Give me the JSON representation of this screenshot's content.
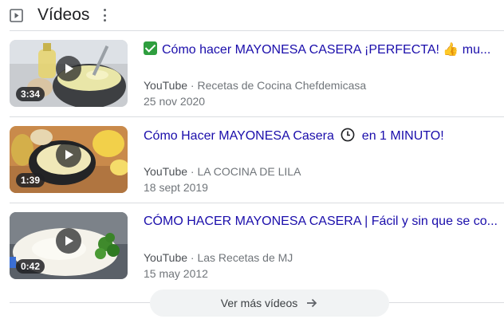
{
  "header": {
    "title": "Vídeos",
    "icon": "play-box-icon",
    "menu_icon": "more-vert-icon"
  },
  "videos": [
    {
      "title_prefix_icon": "check-mark-icon",
      "title": "Cómo hacer MAYONESA CASERA ¡PERFECTA! 👍 mu...",
      "source": "YouTube",
      "channel": "Recetas de Cocina Chefdemicasa",
      "date": "25 nov 2020",
      "duration": "3:34"
    },
    {
      "title_before": "Cómo Hacer MAYONESA Casera",
      "title_icon": "clock-icon",
      "title_after": "en 1 MINUTO!",
      "source": "YouTube",
      "channel": "LA COCINA DE LILA",
      "date": "18 sept 2019",
      "duration": "1:39"
    },
    {
      "title": "CÓMO HACER MAYONESA CASERA | Fácil y sin que se co...",
      "source": "YouTube",
      "channel": "Las Recetas de MJ",
      "date": "15 may 2012",
      "duration": "0:42"
    }
  ],
  "separator": "·",
  "more_button": {
    "label": "Ver más vídeos",
    "icon": "arrow-right-icon"
  },
  "colors": {
    "link": "#1a0dab",
    "meta": "#70757a",
    "check": "#2e9e3e"
  }
}
